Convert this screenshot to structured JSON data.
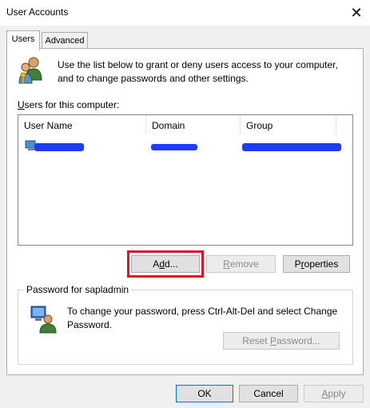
{
  "window": {
    "title": "User Accounts",
    "close_glyph": "✕"
  },
  "tabs": [
    {
      "label": "Users",
      "active": true
    },
    {
      "label": "Advanced",
      "active": false
    }
  ],
  "users_tab": {
    "intro_text": "Use the list below to grant or deny users access to your computer, and to change passwords and other settings.",
    "list_label": "Users for this computer:",
    "columns": [
      "User Name",
      "Domain",
      "Group"
    ],
    "buttons": {
      "add": "Add...",
      "remove": "Remove",
      "properties": "Properties"
    },
    "password_group": {
      "label": "Password for sapladmin",
      "text": "To change your password, press Ctrl-Alt-Del and select Change Password.",
      "reset_button": "Reset Password..."
    }
  },
  "footer": {
    "ok": "OK",
    "cancel": "Cancel",
    "apply": "Apply"
  },
  "colors": {
    "highlight": "#e0102a",
    "redaction": "#1e3cf7",
    "accent": "#0078d7"
  },
  "icons": {
    "users": "users-key-icon",
    "password": "user-computer-icon",
    "row": "user-row-icon"
  }
}
